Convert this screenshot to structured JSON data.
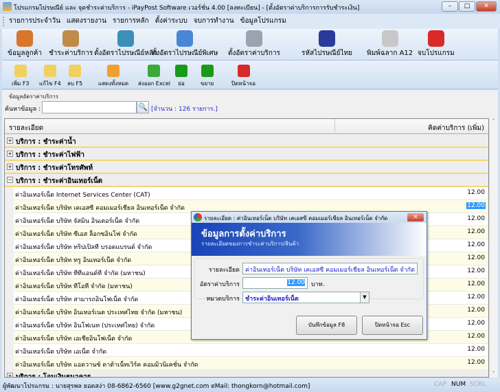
{
  "window": {
    "title": "โปรแกรมไปรษณีย์ และ จุดชำระค่าบริการ - iPayPost Software เวอร์ชั่น 4.00 [ลงทะเบียน] - [ตั้งอัตราค่าบริการการรับชำระเงิน]",
    "minimize": "–",
    "maximize": "□",
    "close": "✕"
  },
  "menu": [
    "รายการประจำวัน",
    "แสดงรายงาน",
    "รายการหลัก",
    "ตั้งค่าระบบ",
    "จบการทำงาน",
    "ข้อมูลโปรแกรม"
  ],
  "main_toolbar": [
    {
      "label": "ข้อมูลลูกค้า",
      "icon": "customers-icon",
      "color": "#d8762c"
    },
    {
      "label": "ชำระค่าบริการ",
      "icon": "wallet-icon",
      "color": "#c08a48"
    },
    {
      "label": "ตั้งอัตราไปรษณีย์หลัก",
      "icon": "mail-globe-icon",
      "color": "#3b8fb8"
    },
    {
      "label": "ตั้งอัตราไปรษณีย์พิเศษ",
      "icon": "refresh-mail-icon",
      "color": "#4a86d8"
    },
    {
      "label": "ตั้งอัตราค่าบริการ",
      "icon": "faucet-icon",
      "color": "#9aa4b0"
    },
    {
      "label": "รหัสไปรษณีย์ไทย",
      "icon": "thai-flag-icon",
      "color": "#2a3a9a"
    },
    {
      "label": "พิมพ์ฉลาก A12",
      "icon": "envelope-icon",
      "color": "#c8c8c8"
    },
    {
      "label": "จบโปรแกรม",
      "icon": "power-icon",
      "color": "#d82a2a"
    }
  ],
  "sub_toolbar": [
    {
      "label": "เพิ่ม F3",
      "icon": "folder-add-icon",
      "color": "#f2d060"
    },
    {
      "label": "แก้ไข F4",
      "icon": "folder-edit-icon",
      "color": "#f2d060"
    },
    {
      "label": "ลบ F5",
      "icon": "folder-delete-icon",
      "color": "#f2d060"
    },
    {
      "label": "แสดงทั้งหมด",
      "icon": "refresh-icon",
      "color": "#f0a030"
    },
    {
      "label": "ส่งออก Excel",
      "icon": "excel-icon",
      "color": "#3aa83a"
    },
    {
      "label": "ย่อ",
      "icon": "arrow-left-icon",
      "color": "#1a9a1a"
    },
    {
      "label": "ขยาย",
      "icon": "arrow-right-icon",
      "color": "#1a9a1a"
    },
    {
      "label": "ปิดหน้าจอ",
      "icon": "power-icon",
      "color": "#d82a2a"
    }
  ],
  "panel": {
    "group_label": "ข้อมูลอัตราค่าบริการ",
    "search_label": "ค้นหาข้อมูล :",
    "search_value": "",
    "count": "[จำนวน : 126 รายการ.]"
  },
  "grid": {
    "columns": [
      "รายละเอียด",
      "คิดค่าบริการ (เพิ่ม)"
    ],
    "rows": [
      {
        "type": "group",
        "expanded": false,
        "label": "บริการ : ชำระค่าน้ำ"
      },
      {
        "type": "group",
        "expanded": false,
        "label": "บริการ : ชำระค่าไฟฟ้า"
      },
      {
        "type": "group",
        "expanded": false,
        "label": "บริการ : ชำระค่าโทรศัพท์"
      },
      {
        "type": "group",
        "expanded": true,
        "label": "บริการ : ชำระค่าอินเทอร์เน็ต"
      },
      {
        "type": "item",
        "label": "ค่าอินเทอร์เน็ต Internet Services Center (CAT)",
        "value": "12.00"
      },
      {
        "type": "item",
        "label": "ค่าอินเทอร์เน็ต บริษัท เคเอสซี คอมเมอร์เชียล อินเทอร์เน็ต จำกัด",
        "value": "12.00",
        "selected": true
      },
      {
        "type": "item",
        "label": "ค่าอินเทอร์เน็ต บริษัท จัสมิน อินเตอร์เน็ต จำกัด",
        "value": "12.00"
      },
      {
        "type": "item",
        "label": "ค่าอินเทอร์เน็ต บริษัท ซีเอส ล็อกซอินโฟ จำกัด",
        "value": "12.00"
      },
      {
        "type": "item",
        "label": "ค่าอินเทอร์เน็ต บริษัท ทริปเปิลที บรอดแบรนด์ จำกัด",
        "value": "12.00"
      },
      {
        "type": "item",
        "label": "ค่าอินเทอร์เน็ต บริษัท ทรู อินเทอร์เน็ต จำกัด",
        "value": "12.00"
      },
      {
        "type": "item",
        "label": "ค่าอินเทอร์เน็ต บริษัท ทีทีแอนด์ที จำกัด (มหาชน)",
        "value": "12.00"
      },
      {
        "type": "item",
        "label": "ค่าอินเทอร์เน็ต บริษัท ทีโอที จำกัด (มหาชน)",
        "value": "12.00"
      },
      {
        "type": "item",
        "label": "ค่าอินเทอร์เน็ต บริษัท สามารถอินโฟเน็ต จำกัด",
        "value": "12.00"
      },
      {
        "type": "item",
        "label": "ค่าอินเทอร์เน็ต บริษัท อินเทอร์เนต ประเทศไทย จำกัด (มหาชน)",
        "value": "12.00"
      },
      {
        "type": "item",
        "label": "ค่าอินเทอร์เน็ต บริษัท อินโฟเนท (ประเทศไทย) จำกัด",
        "value": "12.00"
      },
      {
        "type": "item",
        "label": "ค่าอินเทอร์เน็ต บริษัท เอเชียอินโฟเน็ต จำกัด",
        "value": "12.00"
      },
      {
        "type": "item",
        "label": "ค่าอินเทอร์เน็ต บริษัท เอเน็ต จำกัด",
        "value": "12.00"
      },
      {
        "type": "item",
        "label": "ค่าอินเทอร์เน็ต บริษัท แอดวานซ์ ดาต้าเน็ทเวิร์ค คอมมิวนิเคชั่น จำกัด",
        "value": "12.00"
      },
      {
        "type": "group",
        "expanded": false,
        "label": "บริการ : โอนเงินธนาคาร"
      }
    ]
  },
  "status": {
    "developer": "ผู้พัฒนาโปรแกรม : นายสุรพล ยอดสง่า 08-6862-6560  [www.g2gnet.com  eMail: thongkorn@hotmail.com]",
    "cap": "CAP",
    "num": "NUM",
    "scrl": "SCRL"
  },
  "dialog": {
    "title": "รายละเอียด : ค่าอินเทอร์เน็ต บริษัท เคเอสซี คอมเมอร์เชียล อินเทอร์เน็ต จำกัด",
    "heading": "ข้อมูลการตั้งค่าบริการ",
    "subheading": "รายละเอียดของการชำระค่าบริการ/สินค้า",
    "detail_label": "รายละเอียด",
    "detail_value": "ค่าอินเทอร์เน็ต บริษัท เคเอสซี คอมเมอร์เชียล อินเทอร์เน็ต จำกัด",
    "rate_label": "อัตราค่าบริการ",
    "rate_value": "12.00",
    "rate_unit": "บาท.",
    "category_label": "หมวดบริการ",
    "category_value": "ชำระค่าอินเทอร์เน็ต",
    "save_button": "บันทึกข้อมูล F8",
    "close_button": "ปิดหน้าจอ Esc",
    "close": "✕"
  }
}
